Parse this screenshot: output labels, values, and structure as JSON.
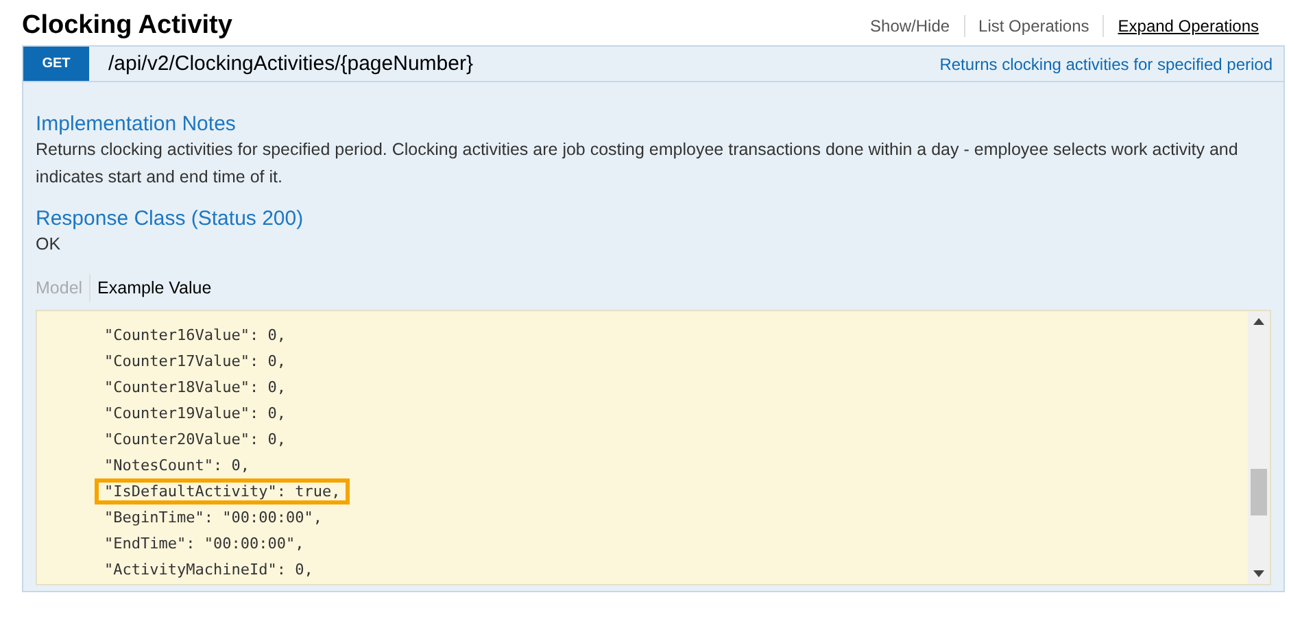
{
  "resource": {
    "title": "Clocking Activity",
    "links": [
      {
        "label": "Show/Hide",
        "selected": false
      },
      {
        "label": "List Operations",
        "selected": false
      },
      {
        "label": "Expand Operations",
        "selected": true
      }
    ]
  },
  "operation": {
    "method": "GET",
    "path": "/api/v2/ClockingActivities/{pageNumber}",
    "summary": "Returns clocking activities for specified period"
  },
  "implementation_notes": {
    "heading": "Implementation Notes",
    "text": "Returns clocking activities for specified period. Clocking activities are job costing employee transactions done within a day - employee selects work activity and indicates start and end time of it."
  },
  "response_class": {
    "heading": "Response Class (Status 200)",
    "text": "OK"
  },
  "tabs": [
    {
      "label": "Model",
      "selected": false
    },
    {
      "label": "Example Value",
      "selected": true
    }
  ],
  "example_lines": [
    {
      "text": "\"Counter16Value\": 0,",
      "highlighted": false
    },
    {
      "text": "\"Counter17Value\": 0,",
      "highlighted": false
    },
    {
      "text": "\"Counter18Value\": 0,",
      "highlighted": false
    },
    {
      "text": "\"Counter19Value\": 0,",
      "highlighted": false
    },
    {
      "text": "\"Counter20Value\": 0,",
      "highlighted": false
    },
    {
      "text": "\"NotesCount\": 0,",
      "highlighted": false
    },
    {
      "text": "\"IsDefaultActivity\": true,",
      "highlighted": true
    },
    {
      "text": "\"BeginTime\": \"00:00:00\",",
      "highlighted": false
    },
    {
      "text": "\"EndTime\": \"00:00:00\",",
      "highlighted": false
    },
    {
      "text": "\"ActivityMachineId\": 0,",
      "highlighted": false
    }
  ]
}
